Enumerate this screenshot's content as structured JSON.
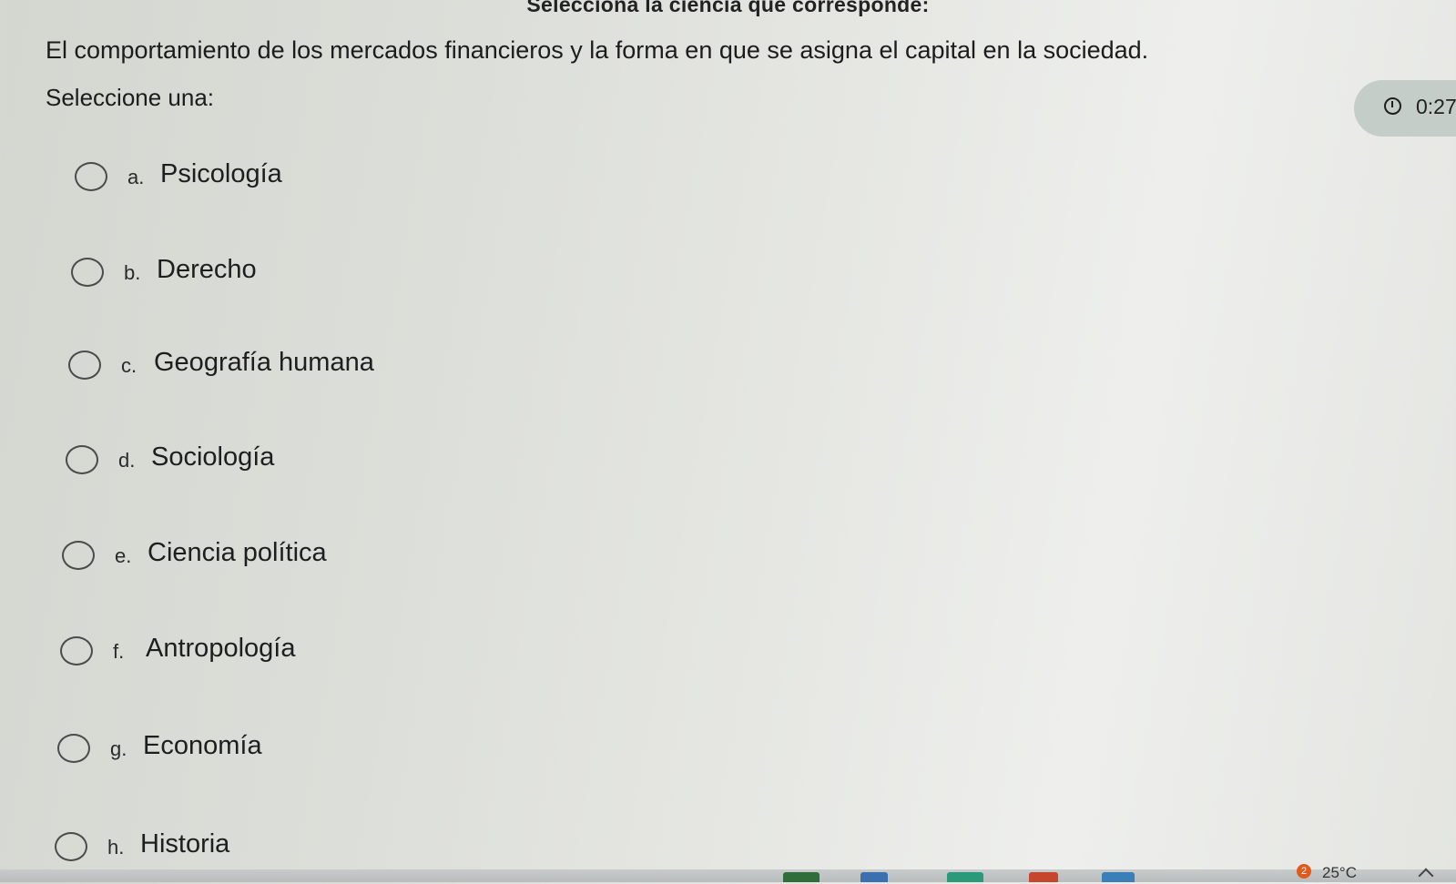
{
  "heading": "Selecciona la ciencia que corresponde:",
  "question": "El comportamiento de los mercados financieros y la forma en que se asigna el capital en la sociedad.",
  "instruction": "Seleccione una:",
  "timer": {
    "text": "0:27",
    "icon": "clock-icon"
  },
  "options": [
    {
      "letter": "a.",
      "label": "Psicología"
    },
    {
      "letter": "b.",
      "label": "Derecho"
    },
    {
      "letter": "c.",
      "label": "Geografía humana"
    },
    {
      "letter": "d.",
      "label": "Sociología"
    },
    {
      "letter": "e.",
      "label": "Ciencia política"
    },
    {
      "letter": "f.",
      "label": "Antropología"
    },
    {
      "letter": "g.",
      "label": "Economía"
    },
    {
      "letter": "h.",
      "label": "Historia"
    }
  ],
  "taskbar": {
    "notification_count": "2",
    "weather": "25°C",
    "icons": [
      "app-icon",
      "app-icon",
      "app-icon",
      "app-icon",
      "app-icon"
    ],
    "colors": [
      "#2f6e3a",
      "#3a6fb0",
      "#2a9a7a",
      "#c8452d",
      "#3a7fb8"
    ]
  }
}
